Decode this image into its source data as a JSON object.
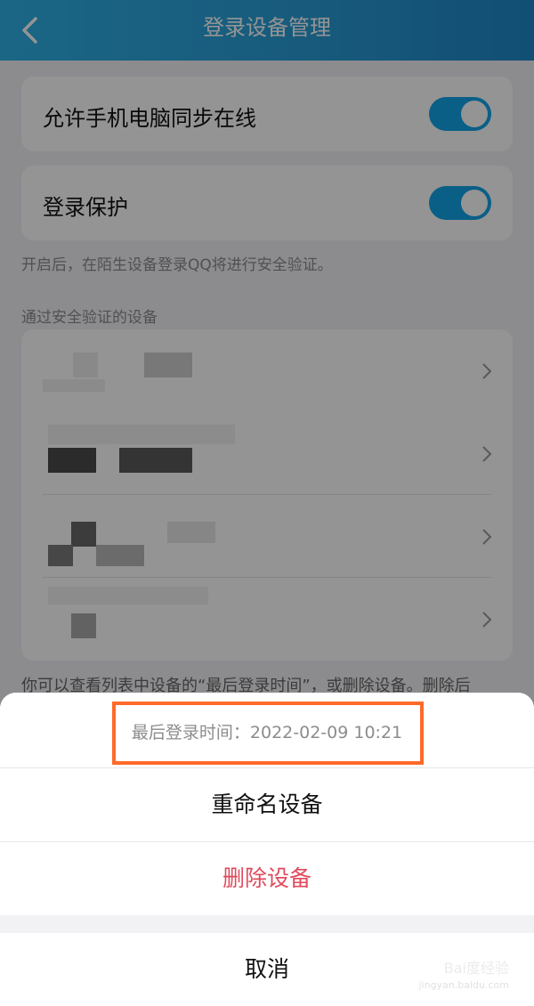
{
  "header": {
    "title": "登录设备管理"
  },
  "settings": {
    "sync_label": "允许手机电脑同步在线",
    "sync_on": true,
    "protect_label": "登录保护",
    "protect_on": true,
    "protect_helper": "开启后，在陌生设备登录QQ将进行安全验证。",
    "verified_label": "通过安全验证的设备"
  },
  "devices_note": "你可以查看列表中设备的“最后登录时间”，或删除设备。删除后",
  "sheet": {
    "last_login": "最后登录时间：2022-02-09 10:21",
    "rename": "重命名设备",
    "delete": "删除设备",
    "cancel": "取消"
  },
  "watermark": {
    "brand": "Bai度经验",
    "url": "jingyan.baidu.com"
  },
  "colors": {
    "accent": "#12a4e8",
    "danger": "#e04a5d",
    "highlight": "#ff6a2a"
  }
}
